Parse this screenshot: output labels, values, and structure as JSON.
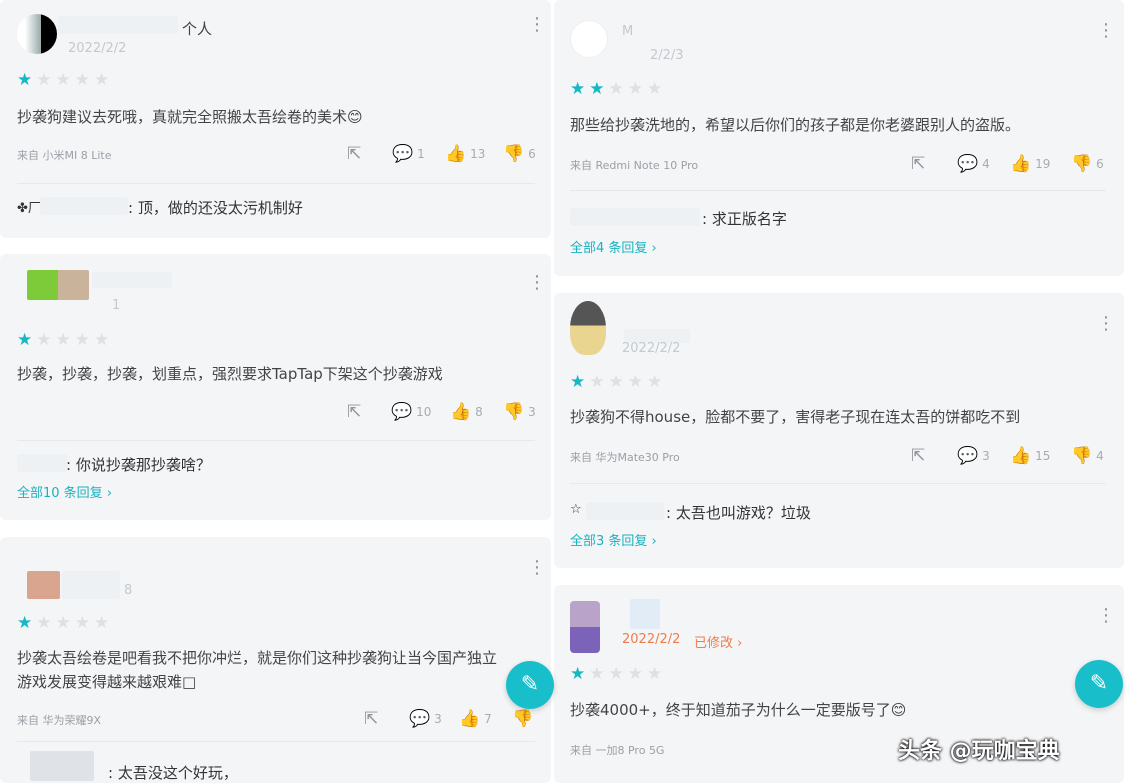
{
  "colors": {
    "accent": "#16b8c5",
    "edited": "#f07b4b",
    "star_off": "#dde0e4"
  },
  "icons": {
    "star": "star-icon",
    "share": "share-icon",
    "comment": "comment-icon",
    "like": "thumbs-up-icon",
    "dislike": "thumbs-down-icon",
    "more": "more-vertical-icon",
    "edit": "pencil-icon"
  },
  "reviews": [
    {
      "name": "个人",
      "date": "2022/2/2",
      "rating": 1,
      "text": "抄袭狗建议去死哦，真就完全照搬太吾绘卷的美术😊",
      "device": "来自 小米MI 8 Lite",
      "comments": "1",
      "likes": "13",
      "dislikes": "6",
      "reply_prefix": "✤厂",
      "reply_text": "顶，做的还没太污机制好"
    },
    {
      "name": "",
      "date": "1",
      "rating": 1,
      "text": "抄袭，抄袭，抄袭，划重点，强烈要求TapTap下架这个抄袭游戏",
      "comments": "10",
      "likes": "8",
      "dislikes": "3",
      "reply_text": "你说抄袭那抄袭啥？",
      "more": "全部10 条回复"
    },
    {
      "name": "",
      "date": "8",
      "rating": 1,
      "text_line1": "抄袭太吾绘卷是吧看我不把你冲烂，就是你们这种抄袭狗让当今国产独立",
      "text_line2": "游戏发展变得越来越艰难□",
      "device": "来自 华为荣耀9X",
      "comments": "3",
      "likes": "7",
      "reply_text": "太吾没这个好玩，"
    },
    {
      "name": "M",
      "date": "2/2/3",
      "rating": 2,
      "text": "那些给抄袭洗地的，希望以后你们的孩子都是你老婆跟别人的盗版。",
      "device": "来自 Redmi Note 10 Pro",
      "comments": "4",
      "likes": "19",
      "dislikes": "6",
      "reply_text": "求正版名字",
      "more": "全部4 条回复"
    },
    {
      "name": "",
      "date": "2022/2/2",
      "rating": 1,
      "text": "抄袭狗不得house，脸都不要了，害得老子现在连太吾的饼都吃不到",
      "device": "来自 华为Mate30 Pro",
      "comments": "3",
      "likes": "15",
      "dislikes": "4",
      "reply_prefix": "☆",
      "reply_text": "太吾也叫游戏？垃圾",
      "more": "全部3 条回复"
    },
    {
      "name": "",
      "date": "2022/2/2",
      "edited": "已修改",
      "rating": 1,
      "text": "抄袭4000+，终于知道茄子为什么一定要版号了😊",
      "device": "来自 一加8 Pro 5G"
    }
  ],
  "watermark": "头条 @玩咖宝典"
}
